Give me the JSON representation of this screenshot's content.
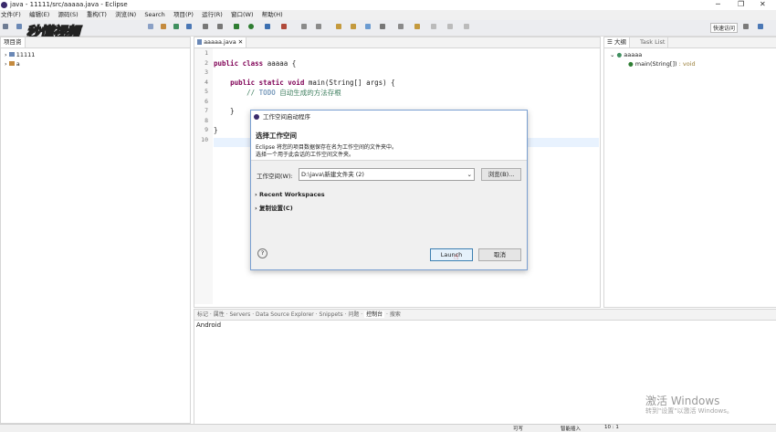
{
  "window": {
    "title": "java - 11111/src/aaaaa.java - Eclipse"
  },
  "menu": [
    "文件(F)",
    "编辑(E)",
    "源码(S)",
    "重构(T)",
    "浏览(N)",
    "Search",
    "项目(P)",
    "运行(R)",
    "窗口(W)",
    "帮助(H)"
  ],
  "toolbar": {
    "quick_access": "快速访问"
  },
  "watermark_logo": "秒懂视频",
  "project_explorer": {
    "tab": "项目资",
    "items": [
      {
        "label": "11111"
      },
      {
        "label": "a"
      }
    ]
  },
  "editor": {
    "tab": "aaaaa.java",
    "line_numbers": [
      "1",
      "2",
      "3",
      "4",
      "5",
      "6",
      "7",
      "8",
      "9",
      "10"
    ],
    "lines": [
      {
        "pre": "",
        "kw": "",
        "rest": ""
      },
      {
        "pre": "",
        "kw": "public class",
        "rest": " aaaaa {"
      },
      {
        "pre": "",
        "kw": "",
        "rest": ""
      },
      {
        "pre": "    ",
        "kw": "public static void",
        "rest": " main(String[] args) {"
      },
      {
        "pre": "        ",
        "kw": "",
        "rest": ""
      },
      {
        "pre": "",
        "kw": "",
        "rest": ""
      },
      {
        "pre": "    }",
        "kw": "",
        "rest": ""
      },
      {
        "pre": "",
        "kw": "",
        "rest": ""
      },
      {
        "pre": "}",
        "kw": "",
        "rest": ""
      },
      {
        "pre": "",
        "kw": "",
        "rest": ""
      }
    ],
    "comment_prefix": "// ",
    "comment_todo": "TODO",
    "comment_text": " 自动生成的方法存根"
  },
  "outline": {
    "tab_outline": "大纲",
    "tab_tasklist": "Task List",
    "class_name": "aaaaa",
    "method": "main(String[])",
    "method_return": " : void"
  },
  "bottom_panel": {
    "tabs": [
      "标记",
      "属性",
      "Servers",
      "Data Source Explorer",
      "Snippets",
      "问题",
      "控制台",
      "搜索"
    ],
    "active_tab": "控制台",
    "console_text": "Android"
  },
  "dialog": {
    "title": "工作空间启动程序",
    "heading": "选择工作空间",
    "desc1": "Eclipse 将您的项目数据保存在名为工作空间的文件夹中。",
    "desc2": "选择一个用于此会话的工作空间文件夹。",
    "workspace_label": "工作空间(W):",
    "workspace_value": "D:\\java\\新建文件夹 (2)",
    "browse_label": "浏览(B)...",
    "recent_label": "Recent Workspaces",
    "copy_label": "复制设置(C)",
    "help_label": "?",
    "launch_label": "Launch",
    "cancel_label": "取消"
  },
  "status": {
    "writable": "可写",
    "insert_mode": "智能插入",
    "position": "10 : 1"
  },
  "windows_watermark": {
    "line1": "激活 Windows",
    "line2": "转到\"设置\"以激活 Windows。"
  }
}
